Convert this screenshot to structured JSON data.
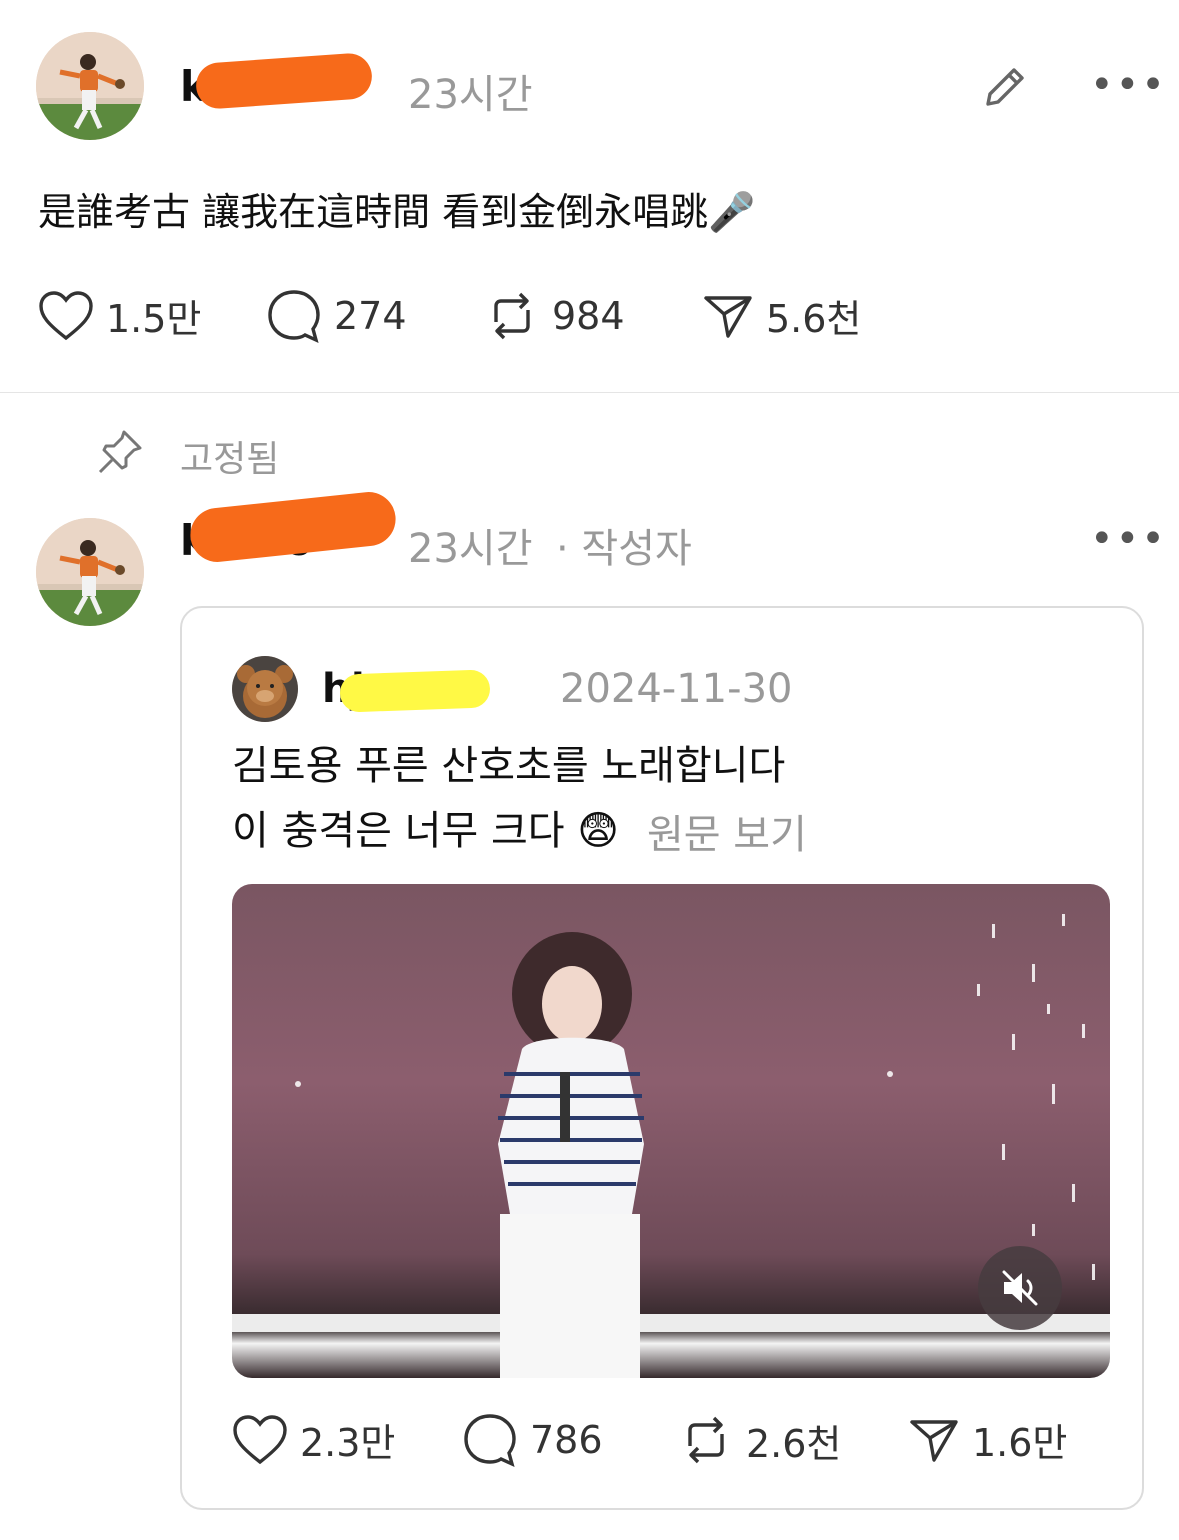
{
  "post": {
    "username": "ka26",
    "time": "23시간",
    "text": "是誰考古 讓我在這時間 看到金倒永唱跳🎤",
    "stats": {
      "likes": "1.5만",
      "replies": "274",
      "reposts": "984",
      "shares": "5.6천"
    }
  },
  "pinned": {
    "label": "고정됨"
  },
  "reply": {
    "username": "ka.26",
    "time": "23시간",
    "author_badge": "· 작성자",
    "quote": {
      "username": "hjz",
      "date": "2024-11-30",
      "line1": "김토용 푸른 산호초를 노래합니다",
      "line2": "이 충격은 너무 크다 😨",
      "view_original": "원문 보기",
      "stats": {
        "likes": "2.3만",
        "replies": "786",
        "reposts": "2.6천",
        "shares": "1.6만"
      }
    }
  },
  "colors": {
    "redaction_orange": "#f76a1a",
    "redaction_yellow": "#fff945",
    "muted_gray": "#999999"
  }
}
